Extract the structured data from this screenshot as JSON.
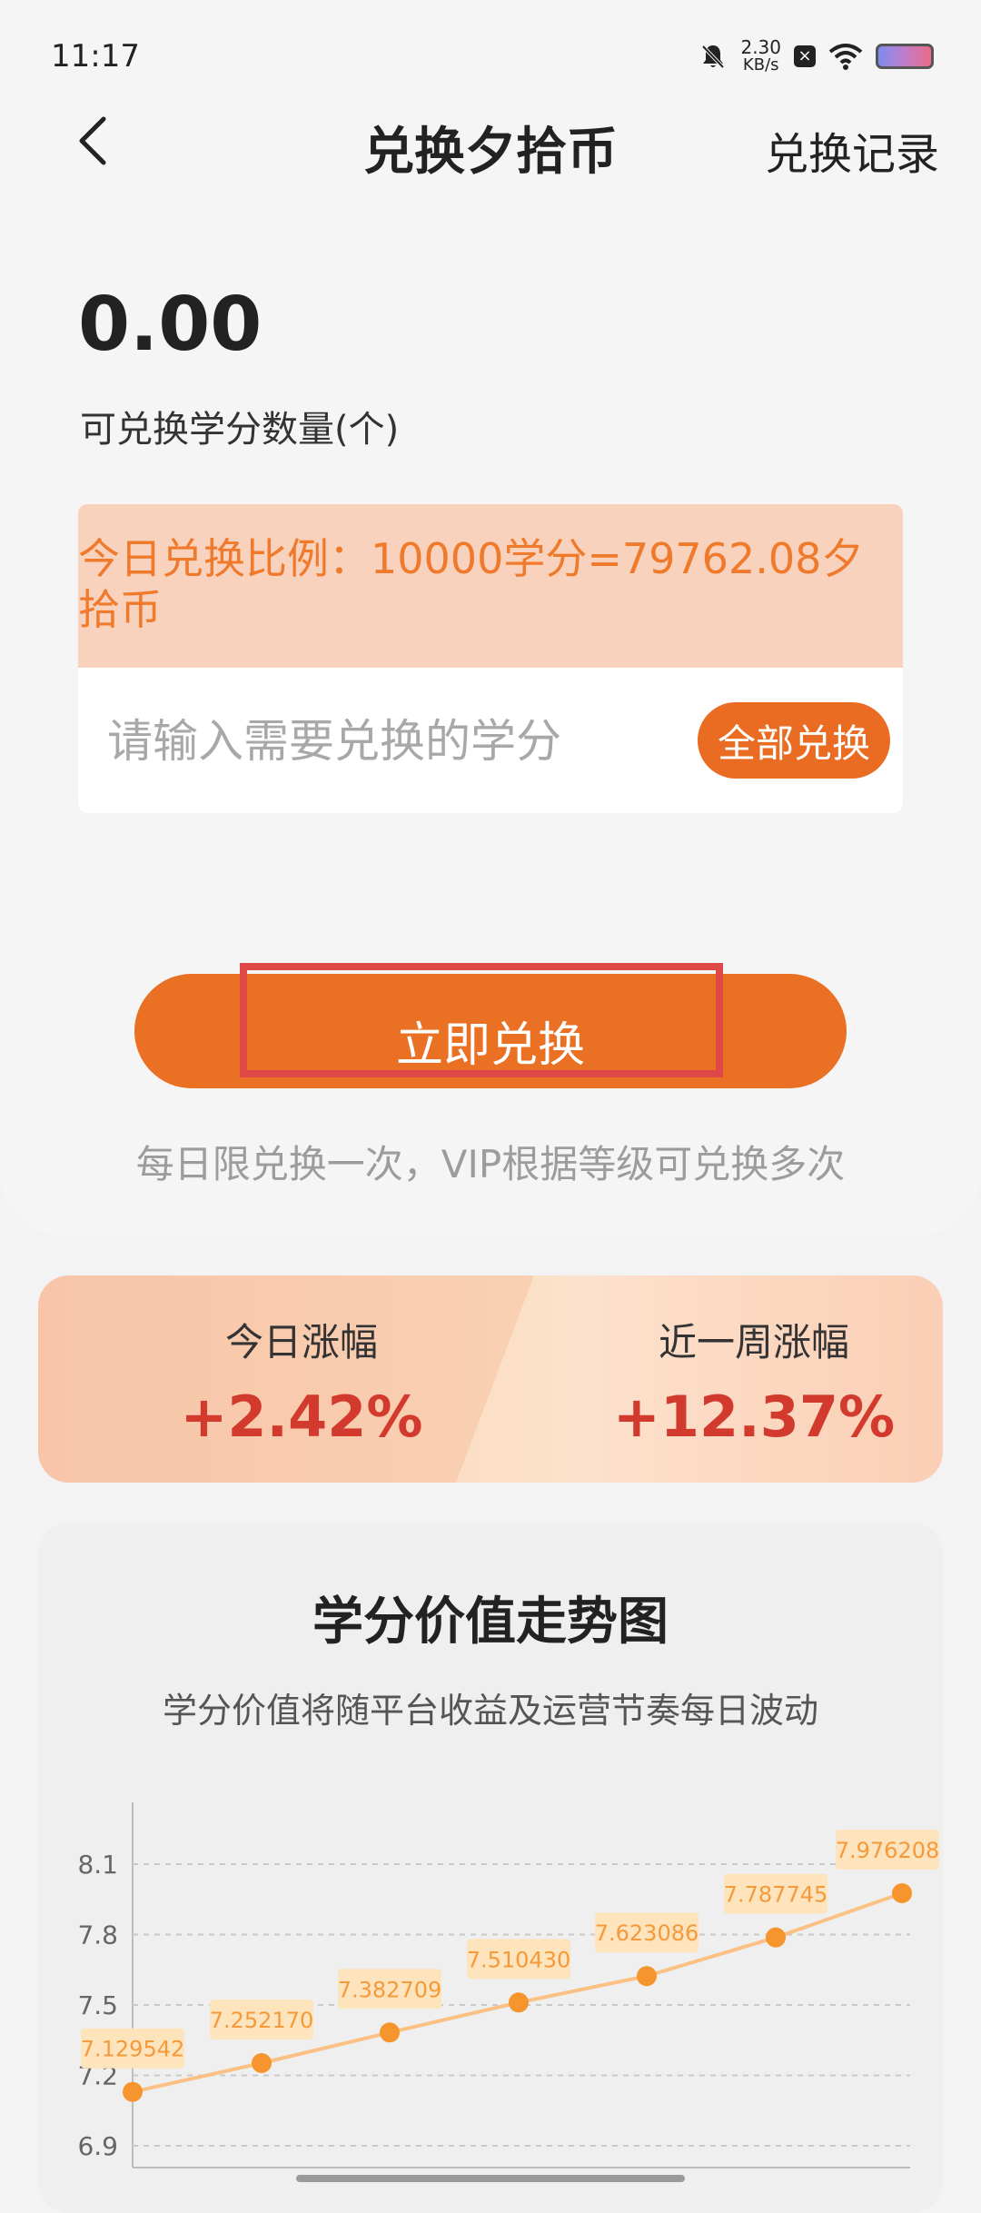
{
  "status_bar": {
    "time": "11:17",
    "net_speed_value": "2.30",
    "net_speed_unit": "KB/s"
  },
  "nav": {
    "title": "兑换夕拾币",
    "record_label": "兑换记录"
  },
  "balance": {
    "value": "0.00",
    "label": "可兑换学分数量(个)"
  },
  "rate": {
    "text": "今日兑换比例：10000学分=79762.08夕拾币"
  },
  "input": {
    "placeholder": "请输入需要兑换的学分",
    "value": ""
  },
  "buttons": {
    "all_label": "全部兑换",
    "exchange_label": "立即兑换"
  },
  "limit_note": "每日限兑换一次，VIP根据等级可兑换多次",
  "stats": {
    "today_label": "今日涨幅",
    "today_value": "+2.42%",
    "week_label": "近一周涨幅",
    "week_value": "+12.37%"
  },
  "trend": {
    "title": "学分价值走势图",
    "subtitle": "学分价值将随平台收益及运营节奏每日波动"
  },
  "colors": {
    "accent": "#ea7024",
    "rate_text": "#ef7a2c",
    "stat_value": "#d33a2e",
    "line": "#fbc083",
    "point": "#f6952e"
  },
  "chart_data": {
    "type": "line",
    "yticks": [
      "6.9",
      "7.2",
      "7.5",
      "7.8",
      "8.1"
    ],
    "ylim": [
      6.9,
      8.1
    ],
    "grid": true,
    "values": [
      7.129542,
      7.25217,
      7.382709,
      7.51043,
      7.623086,
      7.787745,
      7.976208
    ],
    "labels": [
      "7.129542",
      "7.252170",
      "7.382709",
      "7.510430",
      "7.623086",
      "7.787745",
      "7.976208"
    ]
  }
}
